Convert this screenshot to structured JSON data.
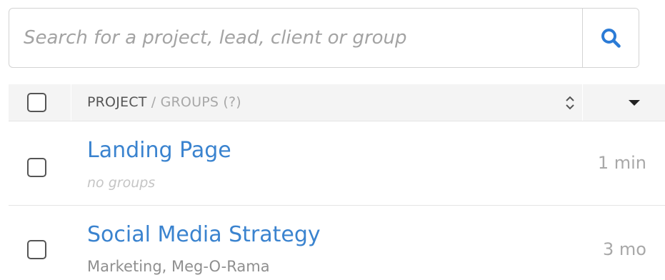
{
  "search": {
    "placeholder": "Search for a project, lead, client or group",
    "icon": "search-icon"
  },
  "table": {
    "header": {
      "project_label": "PROJECT",
      "separator": "/",
      "groups_label": "GROUPS (?)",
      "sort_icon": "sort-updown-icon",
      "menu_icon": "caret-down-icon"
    },
    "rows": [
      {
        "name": "Landing Page",
        "groups": "no groups",
        "time": "1 min"
      },
      {
        "name": "Social Media Strategy",
        "groups": "Marketing, Meg-O-Rama",
        "time": "3 mo"
      }
    ]
  },
  "colors": {
    "link": "#3a83cf",
    "search_icon": "#2b7bd6",
    "header_bg": "#f4f4f4"
  }
}
